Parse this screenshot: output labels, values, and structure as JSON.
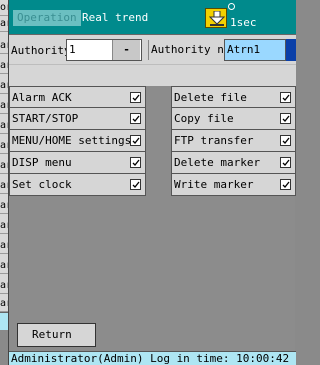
{
  "background_window": {
    "rows": [
      "ord",
      "ar",
      "ar",
      "ar",
      "ar",
      "ar",
      "ar",
      "ar",
      "ar",
      "ar",
      "ar",
      "ar",
      "ar",
      "ar",
      "ar",
      "ar"
    ]
  },
  "titlebar": {
    "mode_tag": "Operation",
    "title": "Real trend",
    "interval": "1sec"
  },
  "authority": {
    "label": "Authority",
    "value": "1",
    "dropdown_symbol": "-",
    "name_label": "Authority name",
    "name_value": "Atrn1"
  },
  "permissions": {
    "left": [
      {
        "label": "Alarm ACK",
        "checked": true
      },
      {
        "label": "START/STOP",
        "checked": true
      },
      {
        "label": "MENU/HOME settings",
        "checked": true
      },
      {
        "label": "DISP menu",
        "checked": true
      },
      {
        "label": "Set clock",
        "checked": true
      }
    ],
    "right": [
      {
        "label": "Delete file",
        "checked": true
      },
      {
        "label": "Copy file",
        "checked": true
      },
      {
        "label": "FTP transfer",
        "checked": true
      },
      {
        "label": "Delete marker",
        "checked": true
      },
      {
        "label": "Write marker",
        "checked": true
      }
    ]
  },
  "footer": {
    "return_label": "Return",
    "status": "Administrator(Admin)  Log in time: 10:00:42"
  },
  "icons": {
    "trend_icon": "download-arrow-icon",
    "check_icon": "checkmark-icon"
  },
  "colors": {
    "titlebar": "#008a8c",
    "highlight_field": "#9ad8ff",
    "status_bar": "#aee6f3",
    "trend_icon": "#f3d000"
  }
}
